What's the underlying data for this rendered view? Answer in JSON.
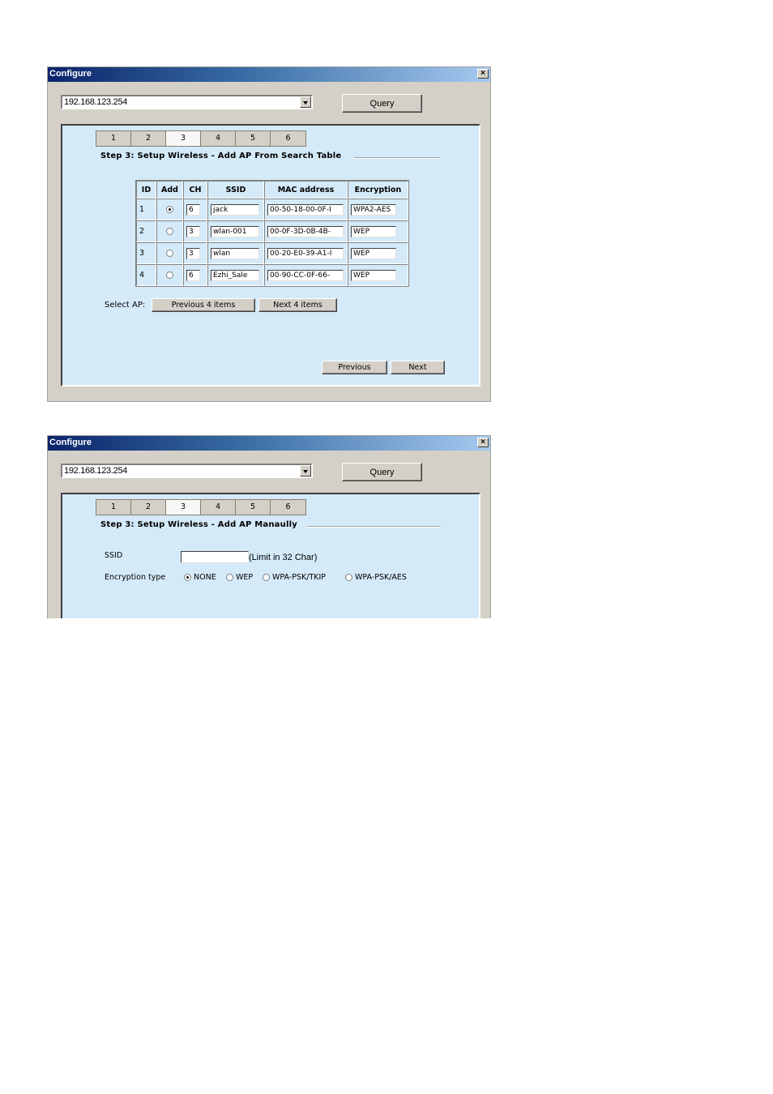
{
  "dialogs": [
    {
      "title": "Configure",
      "ip_combo": {
        "value": "192.168.123.254"
      },
      "query_label": "Query",
      "tabs": [
        "1",
        "2",
        "3",
        "4",
        "5",
        "6"
      ],
      "active_tab": "3",
      "step_title": "Step 3: Setup Wireless - Add AP From Search Table",
      "table": {
        "headers": [
          "ID",
          "Add",
          "CH",
          "SSID",
          "MAC address",
          "Encryption"
        ],
        "rows": [
          {
            "id": "1",
            "selected": true,
            "ch": "6",
            "ssid": "jack",
            "mac": "00-50-18-00-0F-I",
            "enc": "WPA2-AES"
          },
          {
            "id": "2",
            "selected": false,
            "ch": "3",
            "ssid": "wlan-001",
            "mac": "00-0F-3D-0B-4B-",
            "enc": "WEP"
          },
          {
            "id": "3",
            "selected": false,
            "ch": "3",
            "ssid": "wlan",
            "mac": "00-20-E0-39-A1-I",
            "enc": "WEP"
          },
          {
            "id": "4",
            "selected": false,
            "ch": "6",
            "ssid": "Ezhi_Sale",
            "mac": "00-90-CC-0F-66-",
            "enc": "WEP"
          }
        ]
      },
      "select_ap_label": "Select AP:",
      "prev_items_label": "Previous 4 items",
      "next_items_label": "Next 4 items",
      "previous_label": "Previous",
      "next_label": "Next"
    },
    {
      "title": "Configure",
      "ip_combo": {
        "value": "192.168.123.254"
      },
      "query_label": "Query",
      "tabs": [
        "1",
        "2",
        "3",
        "4",
        "5",
        "6"
      ],
      "active_tab": "3",
      "step_title": "Step 3: Setup Wireless - Add AP Manaully",
      "ssid_label": "SSID",
      "ssid_value": "",
      "ssid_hint": "(Limit in 32 Char)",
      "encryption_label": "Encryption type",
      "encryption_options": [
        "NONE",
        "WEP",
        "WPA-PSK/TKIP",
        "WPA-PSK/AES"
      ],
      "encryption_selected": "NONE"
    }
  ]
}
